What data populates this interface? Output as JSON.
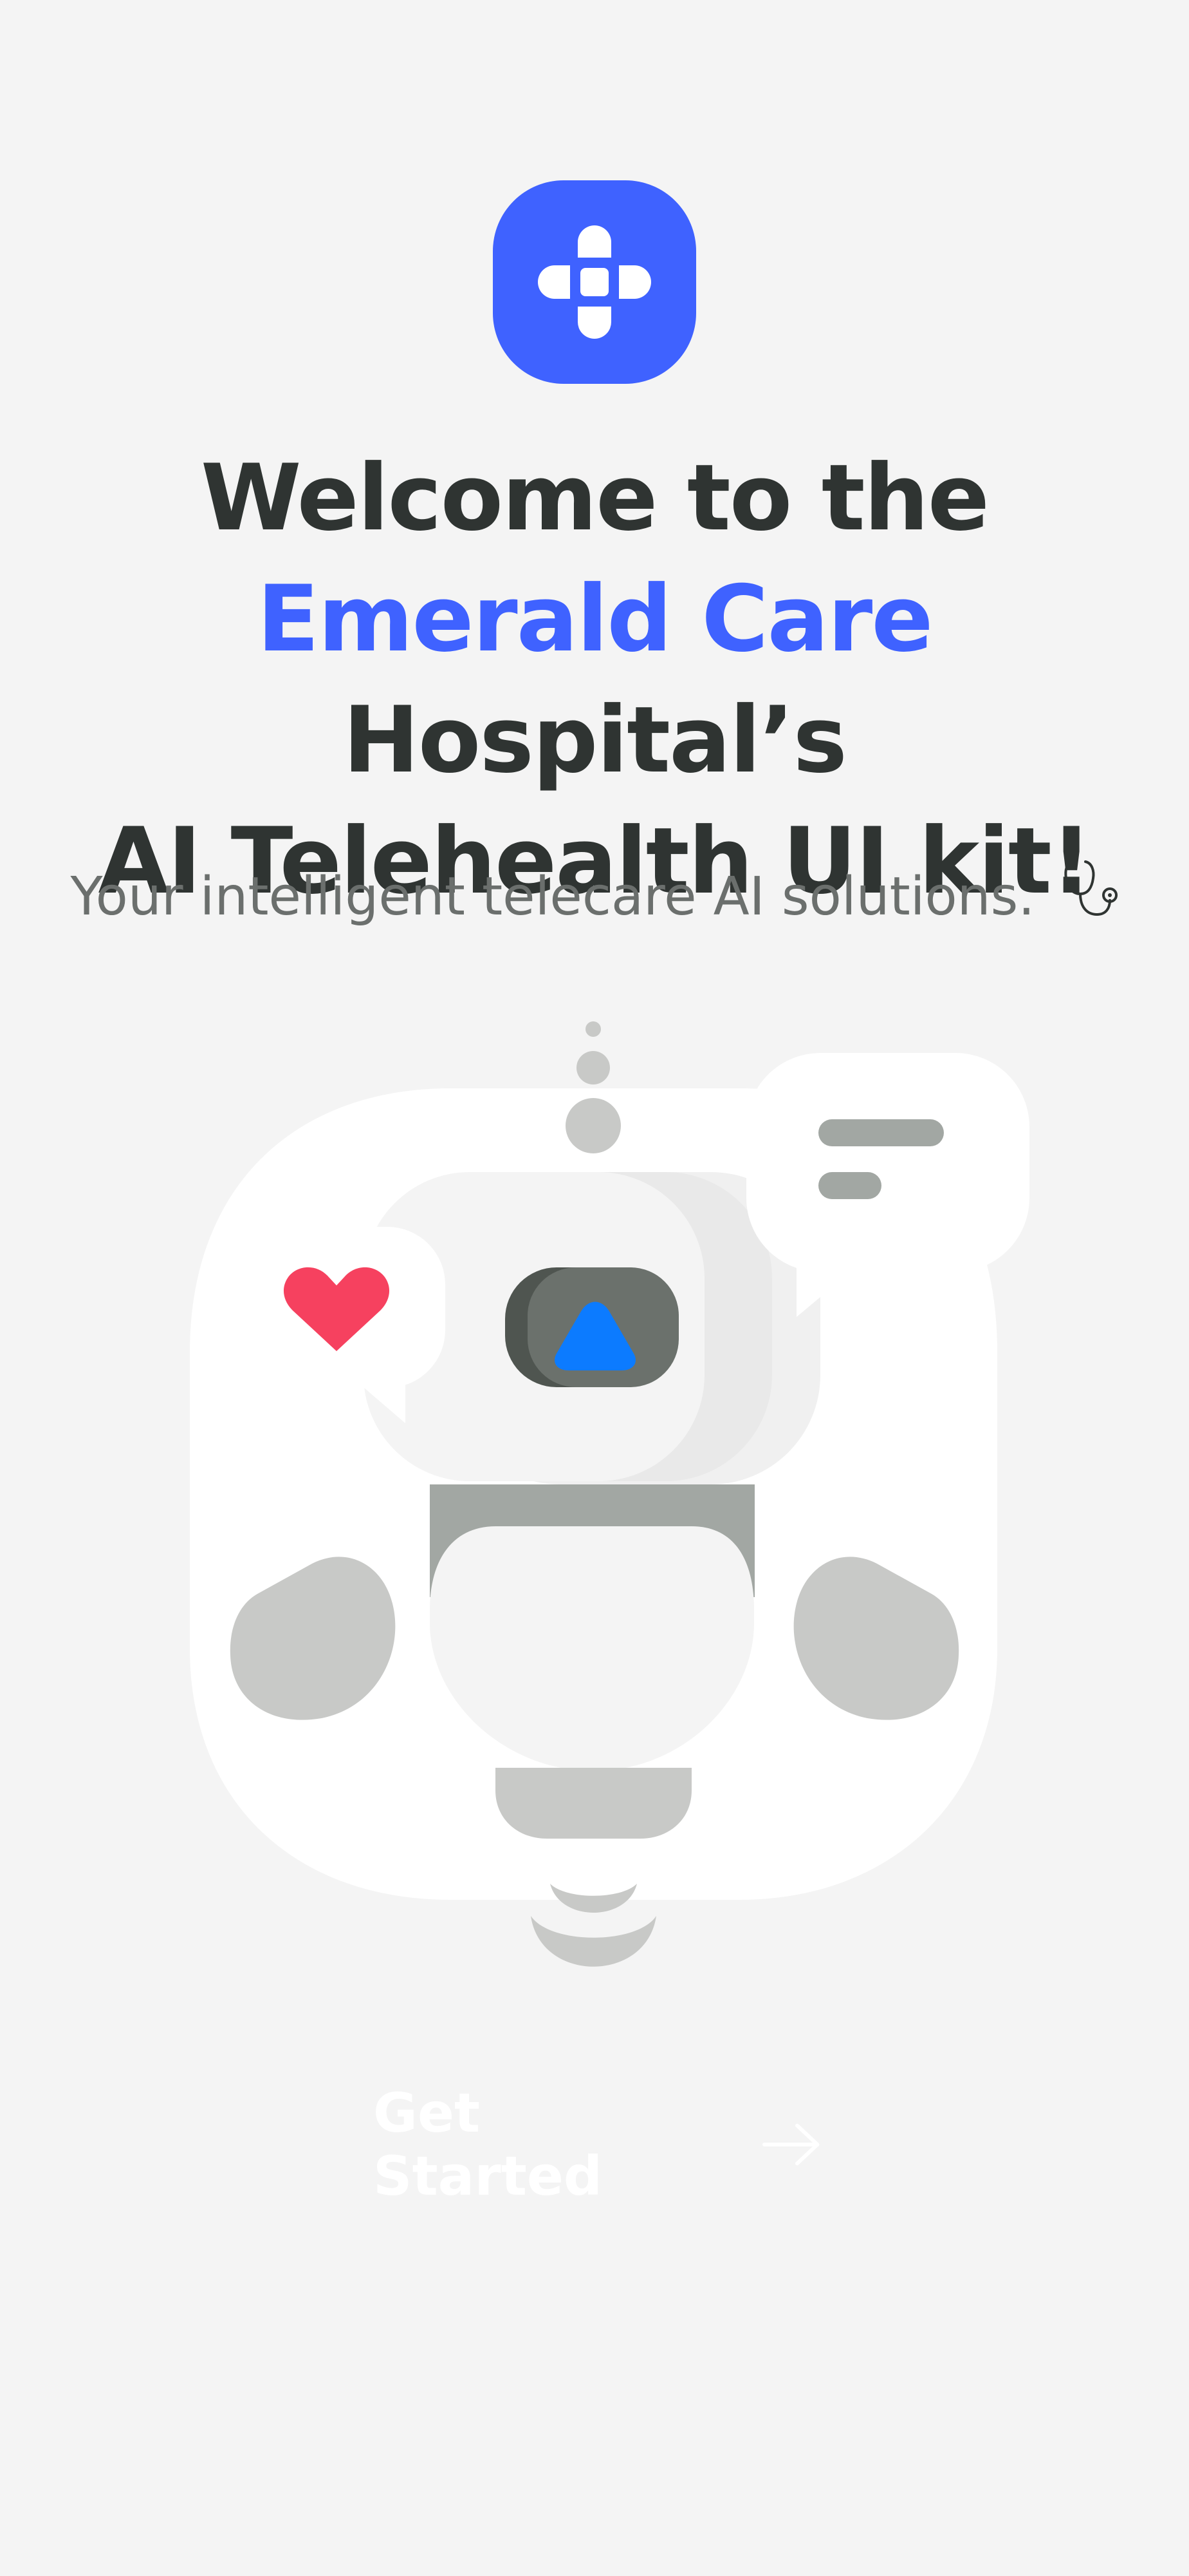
{
  "logo": {
    "icon": "medical-cross-icon",
    "background_color": "#3F62FF"
  },
  "headline": {
    "line1": "Welcome to the",
    "brand": "Emerald Care",
    "line2_rest": "Hospital’s",
    "line3": "AI Telehealth UI kit!",
    "accent_color": "#3F62FF",
    "text_color": "#2F3432"
  },
  "subtitle": {
    "text": "Your intelligent telecare AI solutions.",
    "icon": "stethoscope-icon"
  },
  "illustration": {
    "name": "robot-assistant-illustration",
    "heart_color": "#F6415F",
    "screen_accent_color": "#0C7BFF"
  },
  "cta": {
    "label": "Get Started",
    "icon": "arrow-right-icon",
    "text_color": "#FFFFFF"
  }
}
